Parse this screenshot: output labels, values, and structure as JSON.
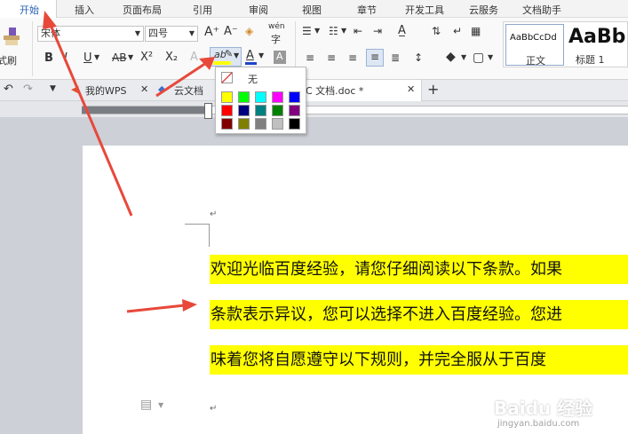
{
  "menu": {
    "items": [
      "开始",
      "插入",
      "页面布局",
      "引用",
      "审阅",
      "视图",
      "章节",
      "开发工具",
      "云服务",
      "文档助手"
    ],
    "active": "开始"
  },
  "toolbar": {
    "font_name": "宋体",
    "font_size": "四号",
    "format_painter_label": "格式刷",
    "bold_label": "B",
    "italic_label": "I",
    "underline_label": "U",
    "strike_label": "AB",
    "superscript_label": "X²",
    "subscript_label": "X₂",
    "grow_font_label": "A⁺",
    "shrink_font_label": "A⁻",
    "wen_label": "wén",
    "font_color_label": "A",
    "highlight_label": "ab",
    "char_shade_label": "A"
  },
  "styles": {
    "normal_preview": "AaBbCcDd",
    "normal_label": "正文",
    "heading1_preview": "AaBb",
    "heading1_label": "标题 1"
  },
  "highlight_menu": {
    "none_label": "无",
    "colors": [
      "#ffff00",
      "#00ff00",
      "#00ffff",
      "#ff00ff",
      "#0000ff",
      "#ff0000",
      "#000080",
      "#008080",
      "#008000",
      "#800080",
      "#800000",
      "#808000",
      "#808080",
      "#c0c0c0",
      "#000000"
    ]
  },
  "doc_tabs": {
    "wps_label": "我的WPS",
    "cloud_label": "云文档",
    "doc_label": "C 文档.doc *",
    "new_tab": "+"
  },
  "document": {
    "return_mark": "↵",
    "lines": [
      "欢迎光临百度经验，请您仔细阅读以下条款。如果",
      "条款表示异议，您可以选择不进入百度经验。您进",
      "味着您将自愿遵守以下规则，并完全服从于百度"
    ]
  },
  "watermark": {
    "brand": "Baidu 经验",
    "url": "jingyan.baidu.com"
  },
  "colors": {
    "arrow": "#e8483a",
    "highlight": "#ffff00",
    "accent": "#2b62b8"
  }
}
